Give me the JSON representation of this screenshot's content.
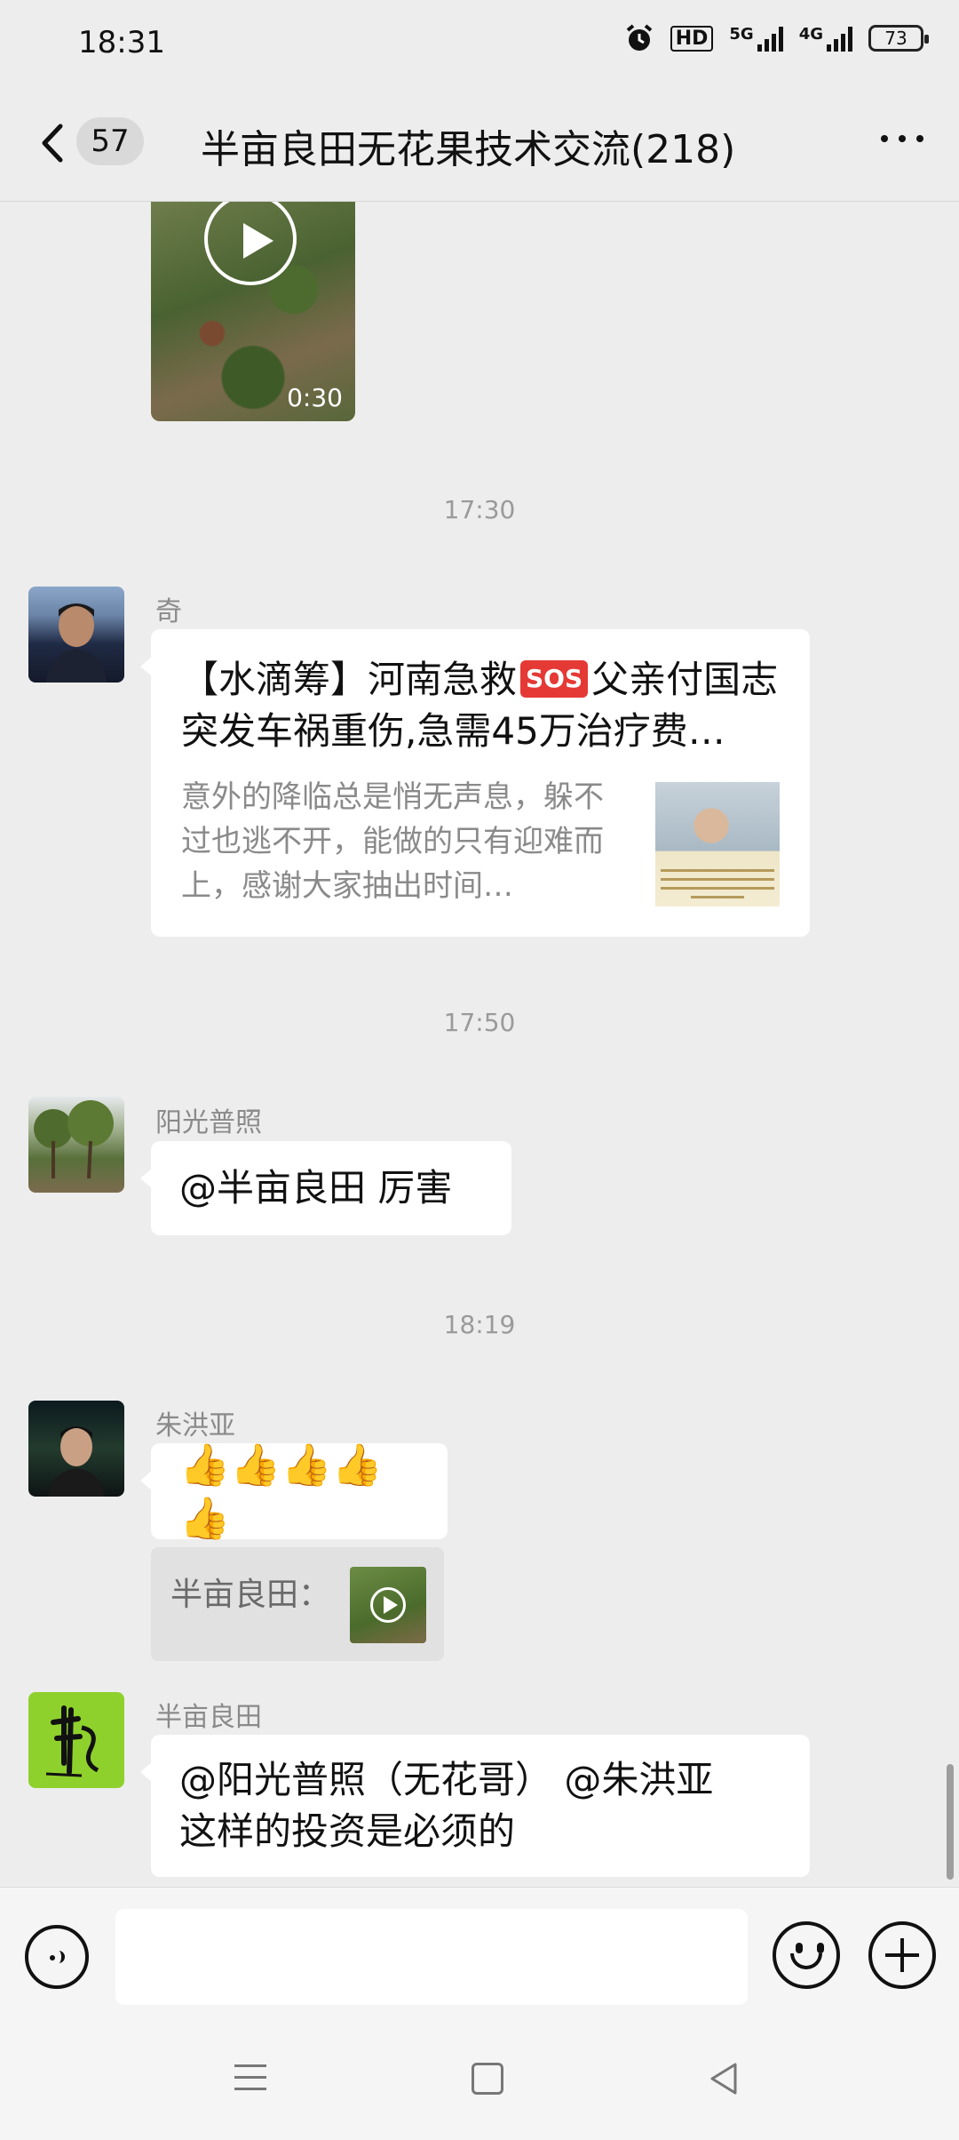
{
  "status_bar": {
    "time": "18:31",
    "hd_label": "HD",
    "net1_label": "5G",
    "net2_label": "4G",
    "battery": "73"
  },
  "header": {
    "unread_count": "57",
    "title": "半亩良田无花果技术交流(218)"
  },
  "messages": {
    "video_duration": "0:30",
    "time_1": "17:30",
    "msg1_sender": "奇",
    "link_title_pre": "【水滴筹】河南急救",
    "sos_label": "SOS",
    "link_title_post": "父亲付国志突发车祸重伤,急需45万治疗费…",
    "link_desc": "意外的降临总是悄无声息，躲不过也逃不开，能做的只有迎难而上，感谢大家抽出时间…",
    "time_2": "17:50",
    "msg2_sender": "阳光普照",
    "msg2_text": "@半亩良田  厉害",
    "time_3": "18:19",
    "msg3_sender": "朱洪亚",
    "msg3_text": "👍👍👍👍👍",
    "msg3_quote": "半亩良田：",
    "msg4_sender": "半亩良田",
    "msg4_line1": "@阳光普照（无花哥） @朱洪亚",
    "msg4_line2": "这样的投资是必须的"
  },
  "input_bar": {
    "placeholder": ""
  },
  "colors": {
    "background": "#ededed",
    "bubble": "#ffffff",
    "timestamp": "#9a9a9a",
    "sos": "#e53935"
  },
  "icons": [
    "back-icon",
    "more-icon",
    "play-icon",
    "voice-icon",
    "emoji-icon",
    "plus-icon",
    "menu-icon",
    "home-icon",
    "back-triangle-icon"
  ]
}
